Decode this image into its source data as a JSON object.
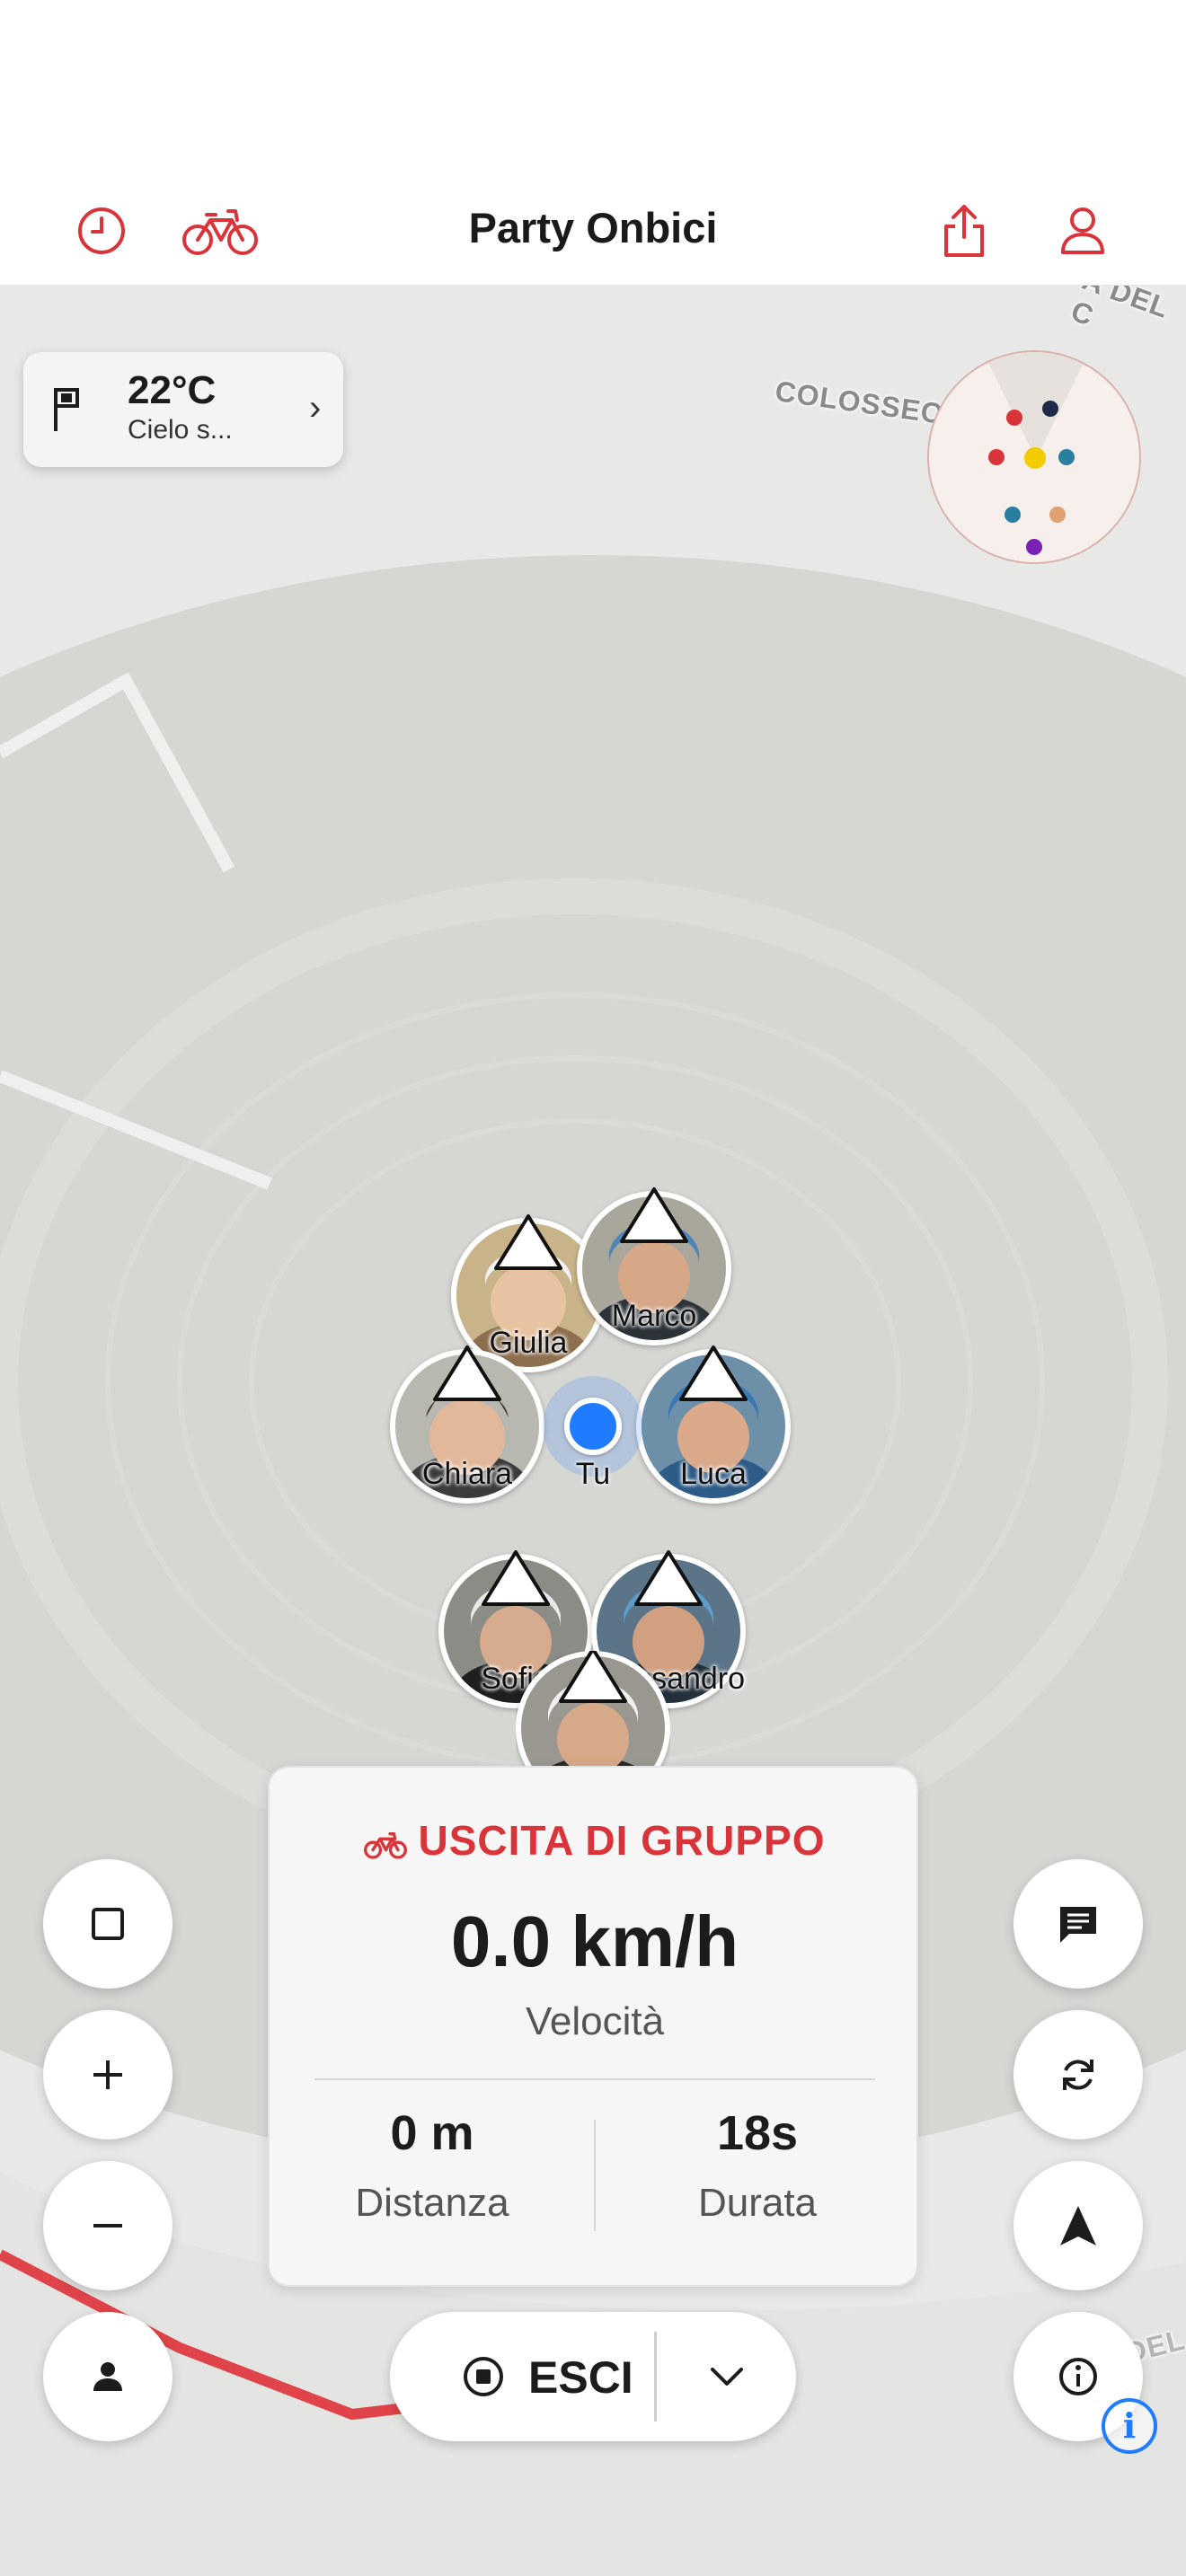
{
  "header": {
    "title": "Party Onbici",
    "accent_color": "#d8343a",
    "icons": [
      "history-icon",
      "bike-icon",
      "share-icon",
      "profile-icon"
    ]
  },
  "map": {
    "labels": {
      "colosseo": "COLOSSEO",
      "top_right": "A DEL C",
      "bottom_right": "A DEL"
    },
    "route_color": "#e0444a"
  },
  "weather": {
    "temperature": "22°C",
    "description": "Cielo s...",
    "chevron": "›"
  },
  "riders": [
    {
      "name": "Giulia"
    },
    {
      "name": "Marco"
    },
    {
      "name": "Chiara"
    },
    {
      "name": "Luca"
    },
    {
      "name": "Sofia"
    },
    {
      "name": "Alessandro"
    },
    {
      "name": ""
    }
  ],
  "me": {
    "label": "Tu",
    "color": "#1f7bff"
  },
  "stats": {
    "mode": "USCITA DI GRUPPO",
    "speed": "0.0 km/h",
    "speed_label": "Velocità",
    "distance_value": "0 m",
    "distance_label": "Distanza",
    "duration_value": "18s",
    "duration_label": "Durata"
  },
  "controls": {
    "left": [
      "square-icon",
      "zoom-in-icon",
      "zoom-out-icon",
      "person-icon"
    ],
    "right": [
      "chat-icon",
      "sync-icon",
      "navigate-icon",
      "info-icon"
    ]
  },
  "exit": {
    "label": "ESCI"
  },
  "info_badge": "i"
}
